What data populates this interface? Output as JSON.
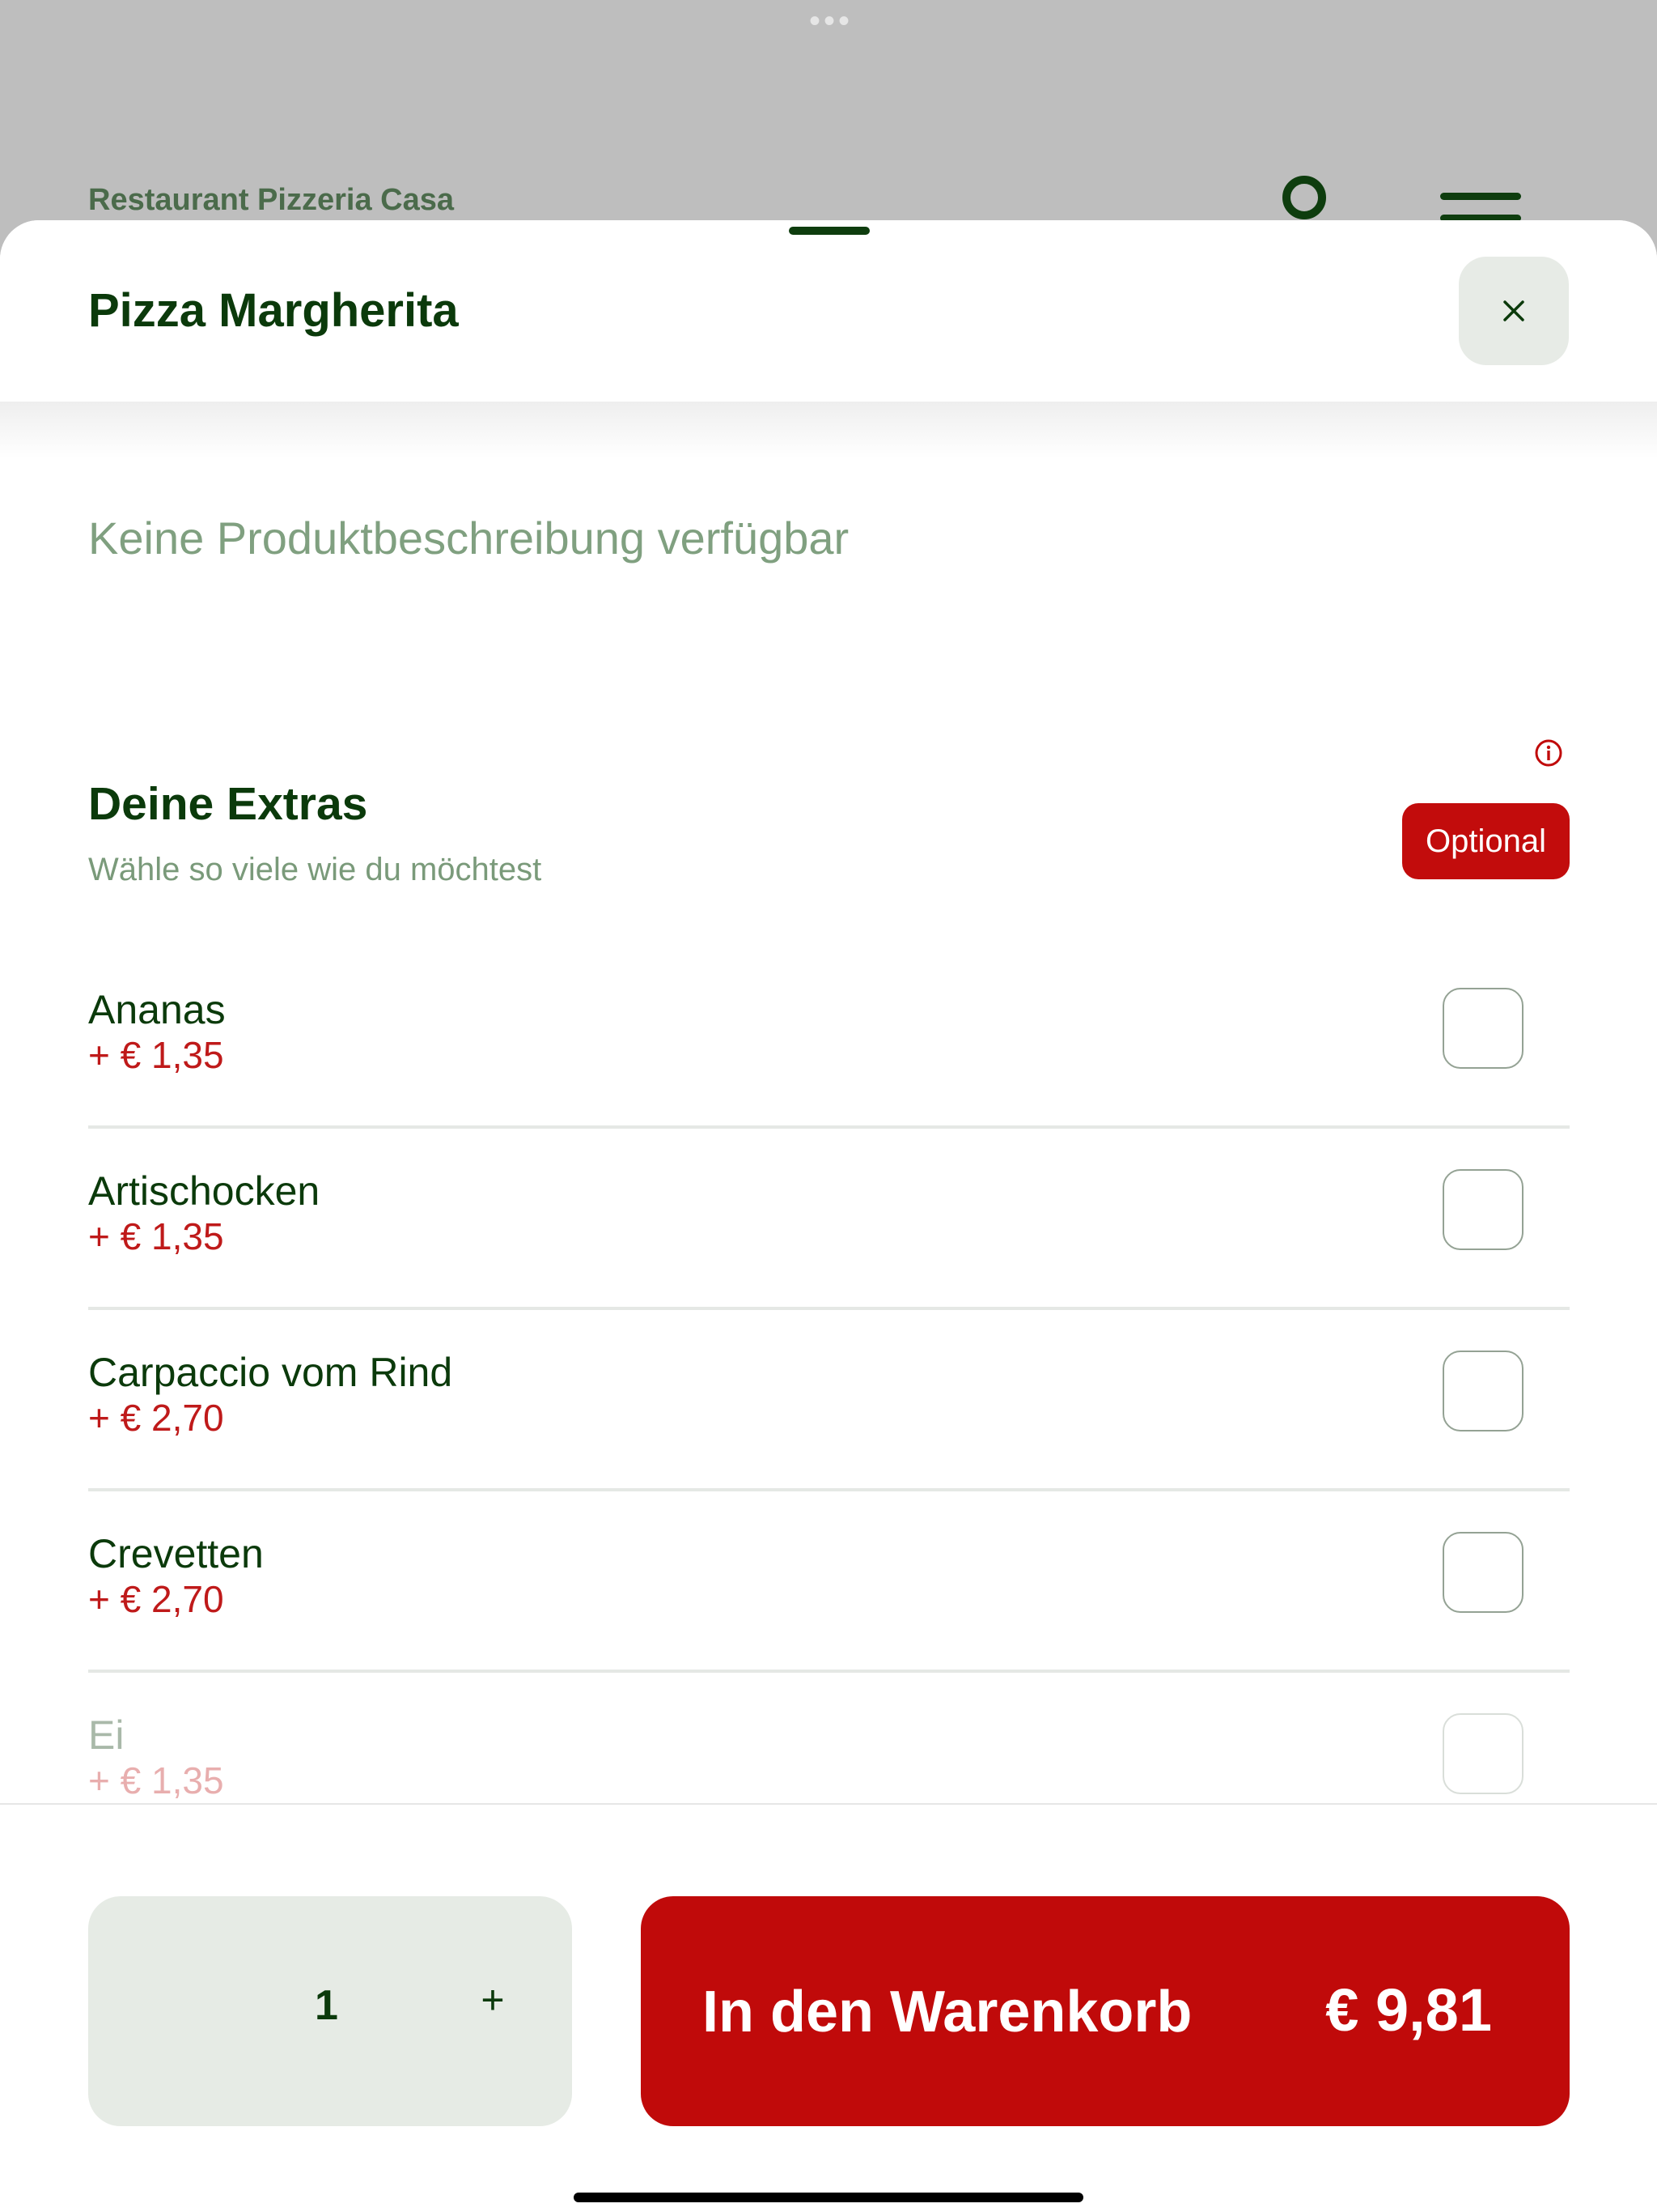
{
  "background": {
    "restaurant_name": "Restaurant Pizzeria Casa",
    "more_indicator": "•••"
  },
  "sheet": {
    "title": "Pizza Margherita",
    "close_icon": "close-icon",
    "description": "Keine Produktbeschreibung verfügbar",
    "info_icon": "info-icon"
  },
  "extras": {
    "title": "Deine Extras",
    "subtitle": "Wähle so viele wie du möchtest",
    "badge": "Optional",
    "items": [
      {
        "name": "Ananas",
        "price": "+ € 1,35",
        "checked": false
      },
      {
        "name": "Artischocken",
        "price": "+ € 1,35",
        "checked": false
      },
      {
        "name": "Carpaccio vom Rind",
        "price": "+ € 2,70",
        "checked": false
      },
      {
        "name": "Crevetten",
        "price": "+ € 2,70",
        "checked": false
      },
      {
        "name": "Ei",
        "price": "+ € 1,35",
        "checked": false
      }
    ]
  },
  "footer": {
    "quantity": "1",
    "plus_label": "+",
    "cart_label": "In den Warenkorb",
    "cart_price": "€ 9,81"
  },
  "colors": {
    "primary_green": "#0b3a0b",
    "accent_red": "#c00a0a",
    "muted_green": "#80a080"
  }
}
